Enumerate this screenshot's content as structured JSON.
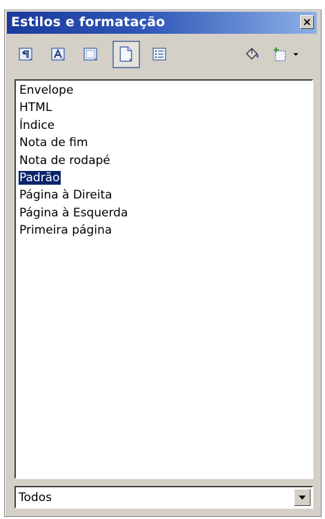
{
  "panel": {
    "title": "Estilos e formatação",
    "close_icon": "close-icon"
  },
  "toolbar": {
    "buttons": [
      {
        "name": "paragraph-styles",
        "icon": "paragraph-styles-icon",
        "active": false
      },
      {
        "name": "character-styles",
        "icon": "character-styles-icon",
        "active": false
      },
      {
        "name": "frame-styles",
        "icon": "frame-styles-icon",
        "active": false
      },
      {
        "name": "page-styles",
        "icon": "page-styles-icon",
        "active": true
      },
      {
        "name": "list-styles",
        "icon": "list-styles-icon",
        "active": false
      },
      {
        "name": "fill-format-mode",
        "icon": "paint-bucket-icon",
        "active": false
      },
      {
        "name": "new-style-from-selection",
        "icon": "new-style-icon",
        "active": false
      }
    ]
  },
  "styles_list": {
    "items": [
      "Envelope",
      "HTML",
      "Índice",
      "Nota de fim",
      "Nota de rodapé",
      "Padrão",
      "Página à Direita",
      "Página à Esquerda",
      "Primeira página"
    ],
    "selected": "Padrão"
  },
  "filter": {
    "value": "Todos"
  },
  "colors": {
    "title_gradient_start": "#1b3a9b",
    "title_gradient_end": "#8eb0e6",
    "selection": "#0a246a",
    "panel_bg": "#d4d0c8"
  }
}
